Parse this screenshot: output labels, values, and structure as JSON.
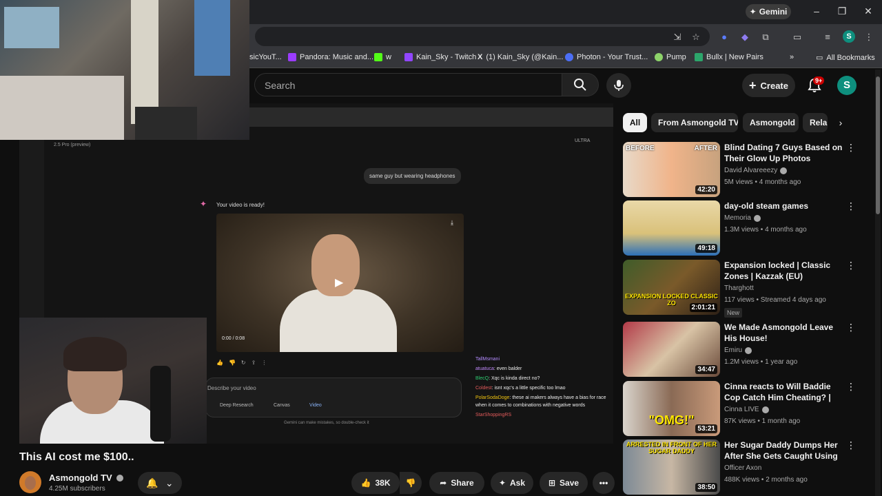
{
  "browser": {
    "gemini_label": "Gemini",
    "bookmarks": [
      {
        "label": "sicYouT...",
        "color": "#cc0000"
      },
      {
        "label": "Pandora: Music and...",
        "color": "#9b3cff"
      },
      {
        "label": "w",
        "color": "#53fc18"
      },
      {
        "label": "Kain_Sky - Twitch",
        "color": "#9146ff"
      },
      {
        "label": "(1) Kain_Sky (@Kain...",
        "color": "#000000"
      },
      {
        "label": "Photon - Your Trust...",
        "color": "#4c6ef5"
      },
      {
        "label": "Pump",
        "color": "#8dd36a"
      },
      {
        "label": "Bullx | New Pairs",
        "color": "#2ca66b"
      }
    ],
    "all_bookmarks": "All Bookmarks",
    "profile_initial": "S"
  },
  "header": {
    "search_placeholder": "Search",
    "create_label": "Create",
    "notif_badge": "9+",
    "avatar_initial": "S"
  },
  "player": {
    "gemini": {
      "model": "2.5 Pro (preview)",
      "ultra": "ULTRA",
      "user_prompt": "same guy but wearing headphones",
      "response": "Your video is ready!",
      "video_time": "0:00 / 0:08",
      "input_placeholder": "Describe your video",
      "tools": [
        "Deep Research",
        "Canvas",
        "Video"
      ],
      "disclaimer": "Gemini can make mistakes, so double-check it"
    },
    "chat": [
      {
        "user": "TallMsmani",
        "color": "#b48cff",
        "text": ""
      },
      {
        "user": "atuatuca",
        "color": "#c38bff",
        "text": "even balder"
      },
      {
        "user": "BlecQ",
        "color": "#2ecc71",
        "text": "Xqc is kinda direct no?"
      },
      {
        "user": "Coldest",
        "color": "#e45b5b",
        "text": "isnt xqc's a little specific too lmao"
      },
      {
        "user": "PolarSodaDoge",
        "color": "#f1c40f",
        "text": "these ai makers always have a bias for race when it comes to combinations with negative words"
      },
      {
        "user": "StarShoppingRS",
        "color": "#e45b5b",
        "text": ""
      }
    ]
  },
  "video": {
    "title": "This AI cost me $100..",
    "channel": "Asmongold TV",
    "subscribers": "4.25M subscribers",
    "likes": "38K",
    "share_label": "Share",
    "ask_label": "Ask",
    "save_label": "Save"
  },
  "chips": [
    "All",
    "From Asmongold TV",
    "Asmongold",
    "Rela"
  ],
  "recommendations": [
    {
      "title": "Blind Dating 7 Guys Based on Their Glow Up Photos",
      "channel": "David Alvareeezy",
      "verified": true,
      "meta": "5M views • 4 months ago",
      "duration": "42:20",
      "overlay_left": "BEFORE",
      "overlay_right": "AFTER",
      "bg": "linear-gradient(90deg,#e8d9c8 0%,#f0b48a 50%,#c7a27e 100%)",
      "new": ""
    },
    {
      "title": "day-old steam games",
      "channel": "Memoria",
      "verified": true,
      "meta": "1.3M views • 4 months ago",
      "duration": "49:18",
      "bg": "linear-gradient(180deg,#e9d8a8 0%,#d9c17a 60%,#2c6fb8 100%)",
      "new": ""
    },
    {
      "title": "Expansion locked | Classic Zones | Kazzak (EU)",
      "channel": "Tharghott",
      "verified": false,
      "meta": "117 views • Streamed 4 days ago",
      "duration": "2:01:21",
      "overlay_big": "EXPANSION LOCKED CLASSIC ZO",
      "bg": "linear-gradient(135deg,#3f5c2a 0%,#7a5a2a 50%,#2d2016 100%)",
      "new": "New"
    },
    {
      "title": "We Made Asmongold Leave His House!",
      "channel": "Emiru",
      "verified": true,
      "meta": "1.2M views • 1 year ago",
      "duration": "34:47",
      "bg": "linear-gradient(135deg,#b23a48 0%,#d8c3a5 50%,#6a4a3a 100%)",
      "new": ""
    },
    {
      "title": "Cinna reacts to Will Baddie Cop Catch Him Cheating? | UDY ...",
      "channel": "Cinna LIVE",
      "verified": true,
      "meta": "87K views • 1 month ago",
      "duration": "53:21",
      "overlay_big": "\"OMG!\"",
      "bg": "linear-gradient(90deg,#d9d4cc 0%,#8a6a55 50%,#c99a7a 100%)",
      "new": ""
    },
    {
      "title": "Her Sugar Daddy Dumps Her After She Gets Caught Using a...",
      "channel": "Officer Axon",
      "verified": false,
      "meta": "488K views • 2 months ago",
      "duration": "38:50",
      "overlay_big": "ARRESTED IN FRONT OF HER SUGAR DADDY",
      "bg": "linear-gradient(90deg,#7d8a96 0%,#c7b7a4 50%,#4a4a4a 100%)",
      "new": ""
    }
  ]
}
